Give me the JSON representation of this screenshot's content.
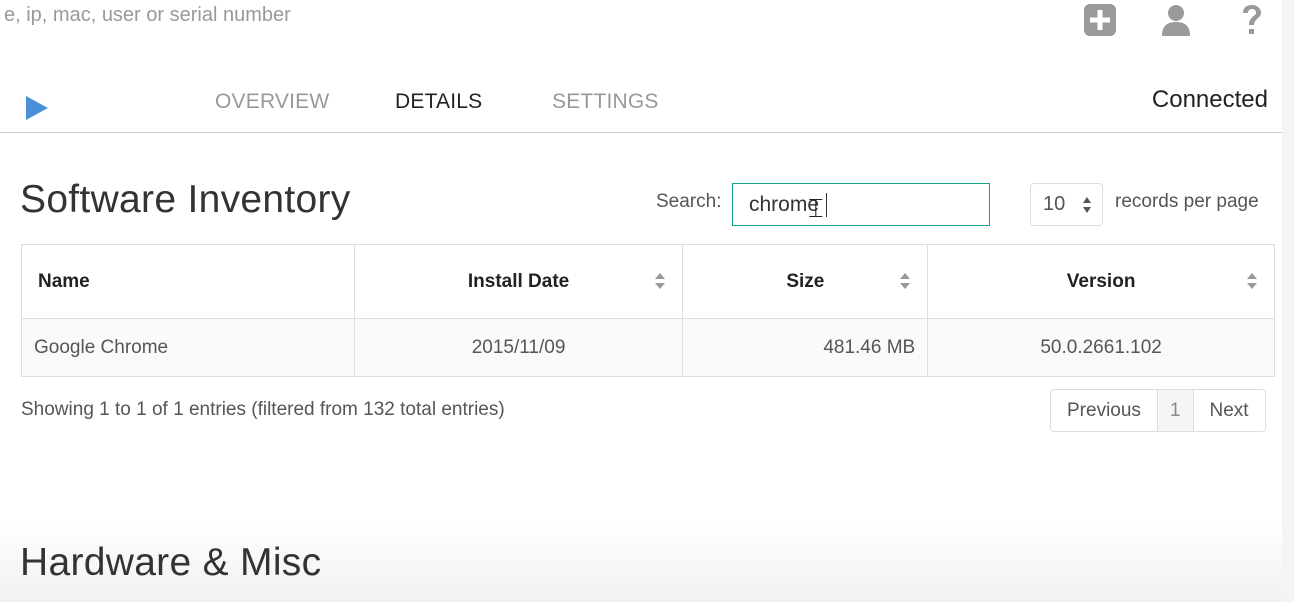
{
  "header": {
    "search_text": "e, ip, mac, user or serial number",
    "icons": [
      "add-square-icon",
      "user-icon",
      "help-icon"
    ]
  },
  "nav": {
    "tabs": [
      {
        "label": "OVERVIEW",
        "active": false
      },
      {
        "label": "DETAILS",
        "active": true
      },
      {
        "label": "SETTINGS",
        "active": false
      }
    ],
    "status": "Connected"
  },
  "software": {
    "title": "Software Inventory",
    "search_label": "Search:",
    "search_value": "chrome",
    "per_page": "10",
    "per_page_label": "records per page",
    "columns": [
      "Name",
      "Install Date",
      "Size",
      "Version"
    ],
    "rows": [
      {
        "name": "Google Chrome",
        "install_date": "2015/11/09",
        "size": "481.46 MB",
        "version": "50.0.2661.102"
      }
    ],
    "info": "Showing 1 to 1 of 1 entries (filtered from 132 total entries)",
    "pager": {
      "previous": "Previous",
      "page": "1",
      "next": "Next"
    }
  },
  "hardware": {
    "title": "Hardware & Misc"
  },
  "colors": {
    "accent": "#16a085",
    "play": "#4a90d9",
    "icon": "#9a9a9a"
  }
}
